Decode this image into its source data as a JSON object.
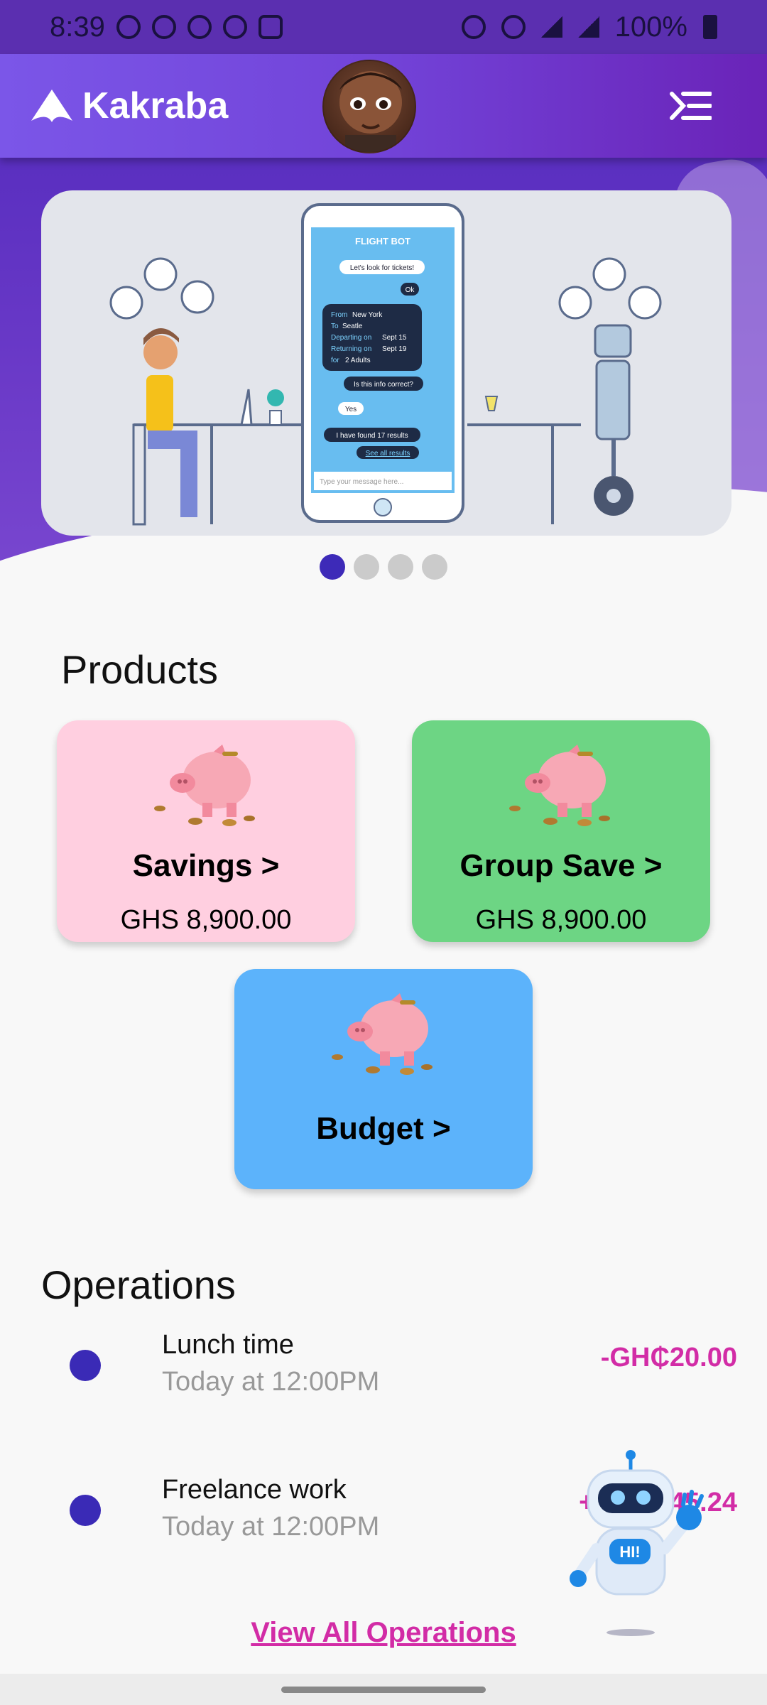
{
  "status_bar": {
    "time": "8:39",
    "battery": "100%"
  },
  "app_bar": {
    "brand": "Kakraba"
  },
  "carousel": {
    "phone_title": "FLIGHT BOT",
    "chat": {
      "msg1": "Let's look for tickets!",
      "msg2": "Ok",
      "from_label": "From",
      "from_value": "New York",
      "to_label": "To",
      "to_value": "Seatle",
      "departing_label": "Departing on",
      "departing_value": "Sept 15",
      "returning_label": "Returning on",
      "returning_value": "Sept 19",
      "for_label": "for",
      "for_value": "2 Adults",
      "msg3": "Is this info correct?",
      "msg4": "Yes",
      "msg5": "I have found 17 results",
      "msg6": "See all results",
      "input_placeholder": "Type your message here..."
    },
    "page_count": 4,
    "active_index": 0
  },
  "products": {
    "title": "Products",
    "items": [
      {
        "label": "Savings >",
        "amount": "GHS 8,900.00"
      },
      {
        "label": "Group Save >",
        "amount": "GHS 8,900.00"
      },
      {
        "label": "Budget >",
        "amount": ""
      }
    ]
  },
  "operations": {
    "title": "Operations",
    "items": [
      {
        "name": "Lunch time",
        "time": "Today at 12:00PM",
        "amount": "-GH₵20.00"
      },
      {
        "name": "Freelance work",
        "time": "Today at 12:00PM",
        "amount": "+GH₵245.24"
      }
    ],
    "view_all": "View All Operations"
  },
  "robot": {
    "badge": "HI!"
  },
  "colors": {
    "app_bar": "#7243d8",
    "savings_card": "#ffcfe0",
    "group_card": "#6dd584",
    "budget_card": "#5cb3fb",
    "accent": "#d22ca6",
    "dot": "#3a2ab6"
  }
}
